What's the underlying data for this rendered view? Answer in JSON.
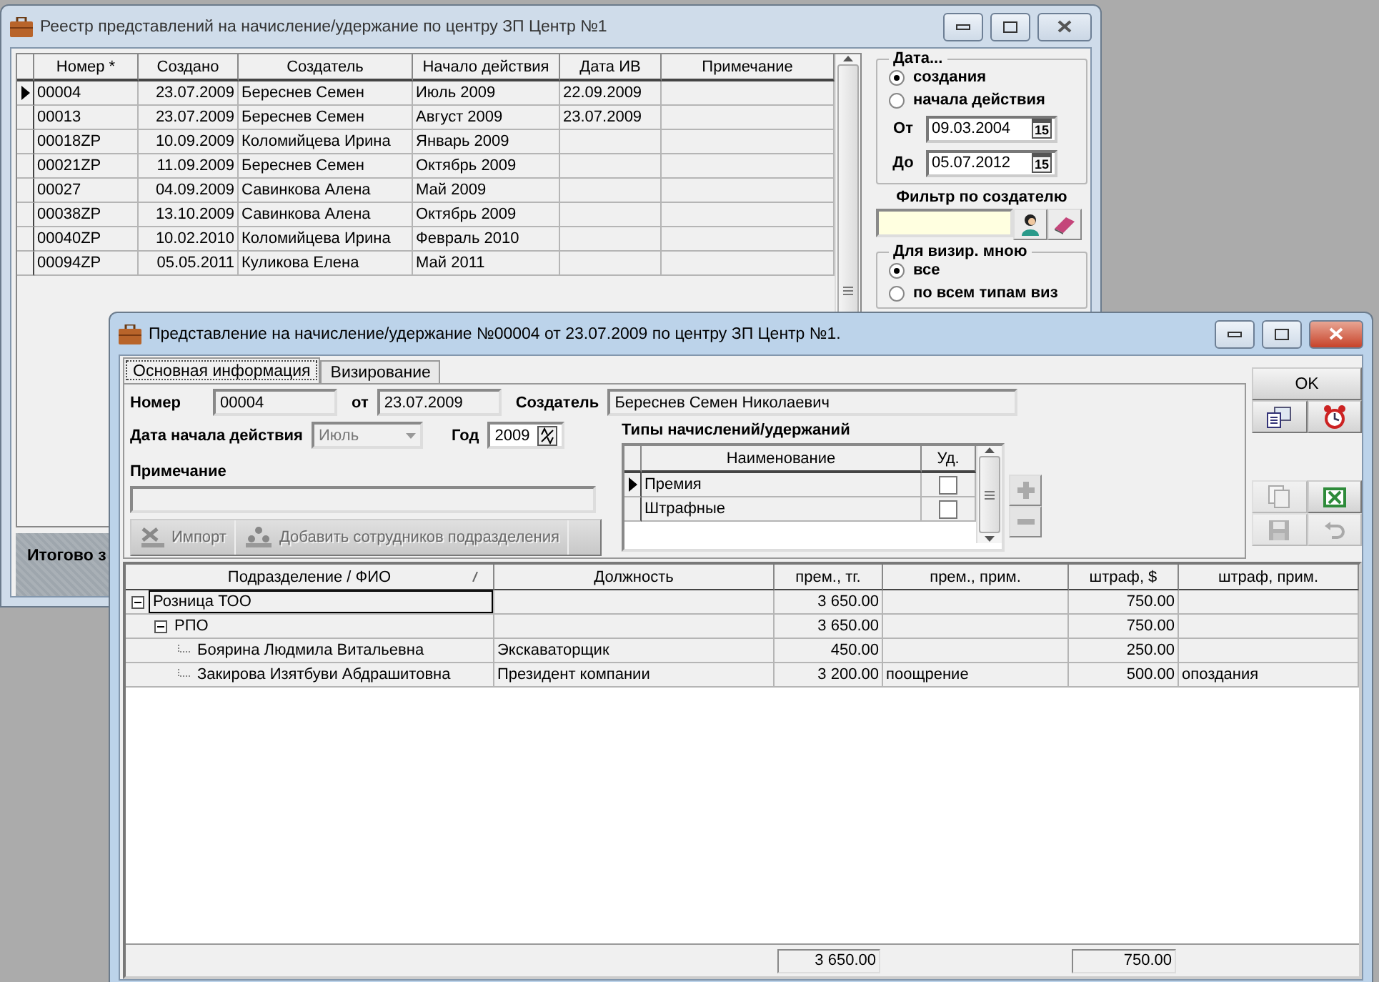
{
  "registry_window": {
    "title": "Реестр представлений на начисление/удержание по центру ЗП Центр №1",
    "columns": [
      "Номер *",
      "Создано",
      "Создатель",
      "Начало действия",
      "Дата ИВ",
      "Примечание"
    ],
    "rows": [
      {
        "selected": true,
        "number": "00004",
        "created": "23.07.2009",
        "creator": "Береснев Семен",
        "start": "Июль 2009",
        "iv_date": "22.09.2009"
      },
      {
        "selected": false,
        "number": "00013",
        "created": "23.07.2009",
        "creator": "Береснев Семен",
        "start": "Август 2009",
        "iv_date": "23.07.2009"
      },
      {
        "selected": false,
        "number": "00018ZP",
        "created": "10.09.2009",
        "creator": "Коломийцева Ирина",
        "start": "Январь 2009"
      },
      {
        "selected": false,
        "number": "00021ZP",
        "created": "11.09.2009",
        "creator": "Береснев Семен",
        "start": "Октябрь 2009"
      },
      {
        "selected": false,
        "number": "00027",
        "created": "04.09.2009",
        "creator": "Савинкова Алена",
        "start": "Май 2009"
      },
      {
        "selected": false,
        "number": "00038ZP",
        "created": "13.10.2009",
        "creator": "Савинкова Алена",
        "start": "Октябрь 2009"
      },
      {
        "selected": false,
        "number": "00040ZP",
        "created": "10.02.2010",
        "creator": "Коломийцева Ирина",
        "start": "Февраль 2010"
      },
      {
        "selected": false,
        "number": "00094ZP",
        "created": "05.05.2011",
        "creator": "Куликова Елена",
        "start": "Май 2011"
      }
    ],
    "date_filter": {
      "title": "Дата...",
      "options": [
        {
          "label": "создания",
          "selected": true
        },
        {
          "label": "начала действия",
          "selected": false
        }
      ],
      "from": {
        "label": "От",
        "value": "09.03.2004",
        "button": "15"
      },
      "to": {
        "label": "До",
        "value": "05.07.2012",
        "button": "15"
      }
    },
    "creator_filter": {
      "title": "Фильтр по создателю"
    },
    "visa_filter": {
      "title": "Для визир. мною",
      "options": [
        {
          "label": "все",
          "selected": true
        },
        {
          "label": "по всем типам виз",
          "selected": false
        }
      ]
    },
    "totals_label": "Итогово з"
  },
  "document_window": {
    "title": "Представление на начисление/удержание №00004 от 23.07.2009 по центру ЗП Центр №1.",
    "tabs": [
      {
        "label": "Основная информация",
        "selected": true
      },
      {
        "label": "Визирование",
        "selected": false
      }
    ],
    "number": {
      "label": "Номер",
      "value": "00004"
    },
    "date": {
      "label": "от",
      "value": "23.07.2009"
    },
    "creator": {
      "label": "Создатель",
      "value": "Береснев Семен Николаевич"
    },
    "start_date": {
      "label": "Дата начала действия",
      "month": "Июль",
      "disabled": true
    },
    "year": {
      "label": "Год",
      "value": "2009"
    },
    "note": {
      "label": "Примечание"
    },
    "actions": [
      {
        "kind": "import",
        "label": "Импорт",
        "disabled": true
      },
      {
        "kind": "add_staff",
        "label": "Добавить сотрудников подразделения",
        "disabled": true
      }
    ],
    "types": {
      "title": "Типы начислений/удержаний",
      "columns": [
        "Наименование",
        "Уд."
      ],
      "rows": [
        {
          "name": "Премия",
          "checked": false,
          "selected": true
        },
        {
          "name": "Штрафные",
          "checked": false,
          "selected": false
        }
      ]
    },
    "ok_button": "OK",
    "tool_buttons": [
      {
        "kind": "report",
        "disabled": false
      },
      {
        "kind": "alarm",
        "disabled": false
      },
      {
        "kind": "copy",
        "disabled": true
      },
      {
        "kind": "excel",
        "disabled": false
      },
      {
        "kind": "save",
        "disabled": true
      },
      {
        "kind": "undo",
        "disabled": true
      }
    ],
    "tree": {
      "columns": [
        "Подразделение / ФИО",
        "Должность",
        "прем., тг.",
        "прем., прим.",
        "штраф, $",
        "штраф, прим."
      ],
      "rows": [
        {
          "name": "Розница ТОО",
          "premium": "3 650.00",
          "fine": "750.00",
          "expanded": true,
          "children": [
            {
              "name": "РПО",
              "premium": "3 650.00",
              "fine": "750.00",
              "expanded": true,
              "children": [
                {
                  "name": "Боярина Людмила Витальевна",
                  "position": "Экскаваторщик",
                  "premium": "450.00",
                  "fine": "250.00"
                },
                {
                  "name": "Закирова   Изятбуви Абдрашитовна",
                  "position": "Президент компании",
                  "premium": "3 200.00",
                  "premium_note": "поощрение",
                  "fine": "500.00",
                  "fine_note": "опоздания"
                }
              ]
            }
          ]
        }
      ]
    },
    "totals": {
      "premium": "3 650.00",
      "fine": "750.00"
    }
  }
}
